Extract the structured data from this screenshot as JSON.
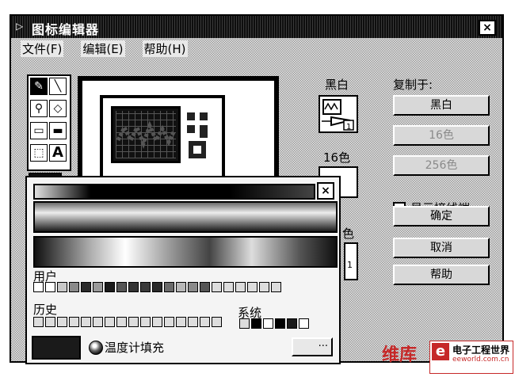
{
  "window": {
    "title": "图标编辑器",
    "close_glyph": "×"
  },
  "menu": [
    "文件(F)",
    "编辑(E)",
    "帮助(H)"
  ],
  "tools": [
    {
      "icon": "pencil-icon",
      "glyph": "✎"
    },
    {
      "icon": "line-icon",
      "glyph": "╲"
    },
    {
      "icon": "dropper-icon",
      "glyph": "⚲"
    },
    {
      "icon": "fill-bucket-icon",
      "glyph": "◇"
    },
    {
      "icon": "rectangle-icon",
      "glyph": "▭"
    },
    {
      "icon": "filled-rectangle-icon",
      "glyph": "▬"
    },
    {
      "icon": "select-icon",
      "glyph": "⬚"
    },
    {
      "icon": "text-icon",
      "glyph": "A"
    }
  ],
  "preview": {
    "bw_label": "黑白",
    "c16_label": "16色",
    "c256_label_fragment": "色",
    "terminal_number": "1"
  },
  "copy_from": {
    "label": "复制于:",
    "bw": "黑白",
    "c16": "16色",
    "c256": "256色"
  },
  "show_terminals": "显示接线端",
  "buttons": {
    "ok": "确定",
    "cancel": "取消",
    "help": "帮助"
  },
  "palette": {
    "close_glyph": "×",
    "user_label": "用户",
    "history_label": "历史",
    "system_label": "系统",
    "temperature_fill": "温度计填充",
    "more_glyph": "···",
    "user_colors": [
      "#ffffff",
      "#ffffff",
      "#c8c8c8",
      "#8a8a8a",
      "#2a2a2a",
      "#9a9a9a",
      "#1a1a1a",
      "#555555",
      "#333333",
      "#3a3a3a",
      "#2a2a2a",
      "#6a6a6a",
      "#b8b8b8",
      "#8a8a8a",
      "#555555",
      "#dddddd",
      "#dddddd",
      "#dddddd",
      "#dddddd",
      "#dddddd",
      "#dddddd"
    ],
    "history_colors": [
      "#dddddd",
      "#dddddd",
      "#dddddd",
      "#dddddd",
      "#dddddd",
      "#dddddd",
      "#dddddd",
      "#dddddd",
      "#dddddd",
      "#dddddd",
      "#dddddd",
      "#dddddd",
      "#dddddd",
      "#dddddd",
      "#dddddd",
      "#dddddd"
    ],
    "system_colors": [
      "#dddddd",
      "#000000",
      "#ffffff",
      "#000000",
      "#1a1a1a",
      "#ffffff"
    ]
  },
  "watermark": {
    "site": "维库",
    "brand": "电子工程世界",
    "url": "eeworld.com.cn",
    "e": "e"
  }
}
